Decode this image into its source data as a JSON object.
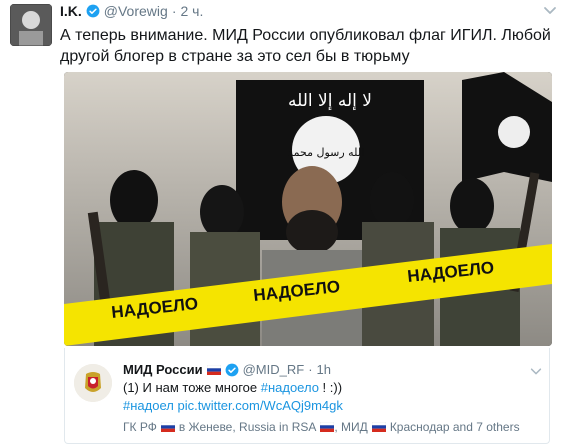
{
  "tweet": {
    "name": "I.K.",
    "handle": "@Vorewig",
    "dot": "·",
    "time": "2 ч.",
    "text": "А теперь внимание. МИД России опубликовал флаг ИГИЛ. Любой другой блогер в стране за это сел бы в тюрьму"
  },
  "media": {
    "flag_text_top": "لا إله إلا الله",
    "flag_text_circle": "الله رسول محمد",
    "tape_word": "НАДОЕЛО",
    "colors": {
      "tape": "#f5e400",
      "flag": "#111111"
    }
  },
  "quote": {
    "name": "МИД России",
    "handle": "@MID_RF",
    "dot": "·",
    "time": "1h",
    "text_prefix": "(1) И нам тоже многое ",
    "text_hashtag": "#надоело",
    "text_suffix": " ! :))",
    "hashtag2": "#надоел",
    "link": "pic.twitter.com/WcAQj9m4gk",
    "footer_a": "ГК РФ",
    "footer_b": "в Женеве, Russia in RSA",
    "footer_c": ", МИД",
    "footer_d": "Краснодар and 7 others"
  },
  "colors": {
    "link": "#1b95e0",
    "verified": "#1da1f2",
    "muted": "#657786"
  }
}
